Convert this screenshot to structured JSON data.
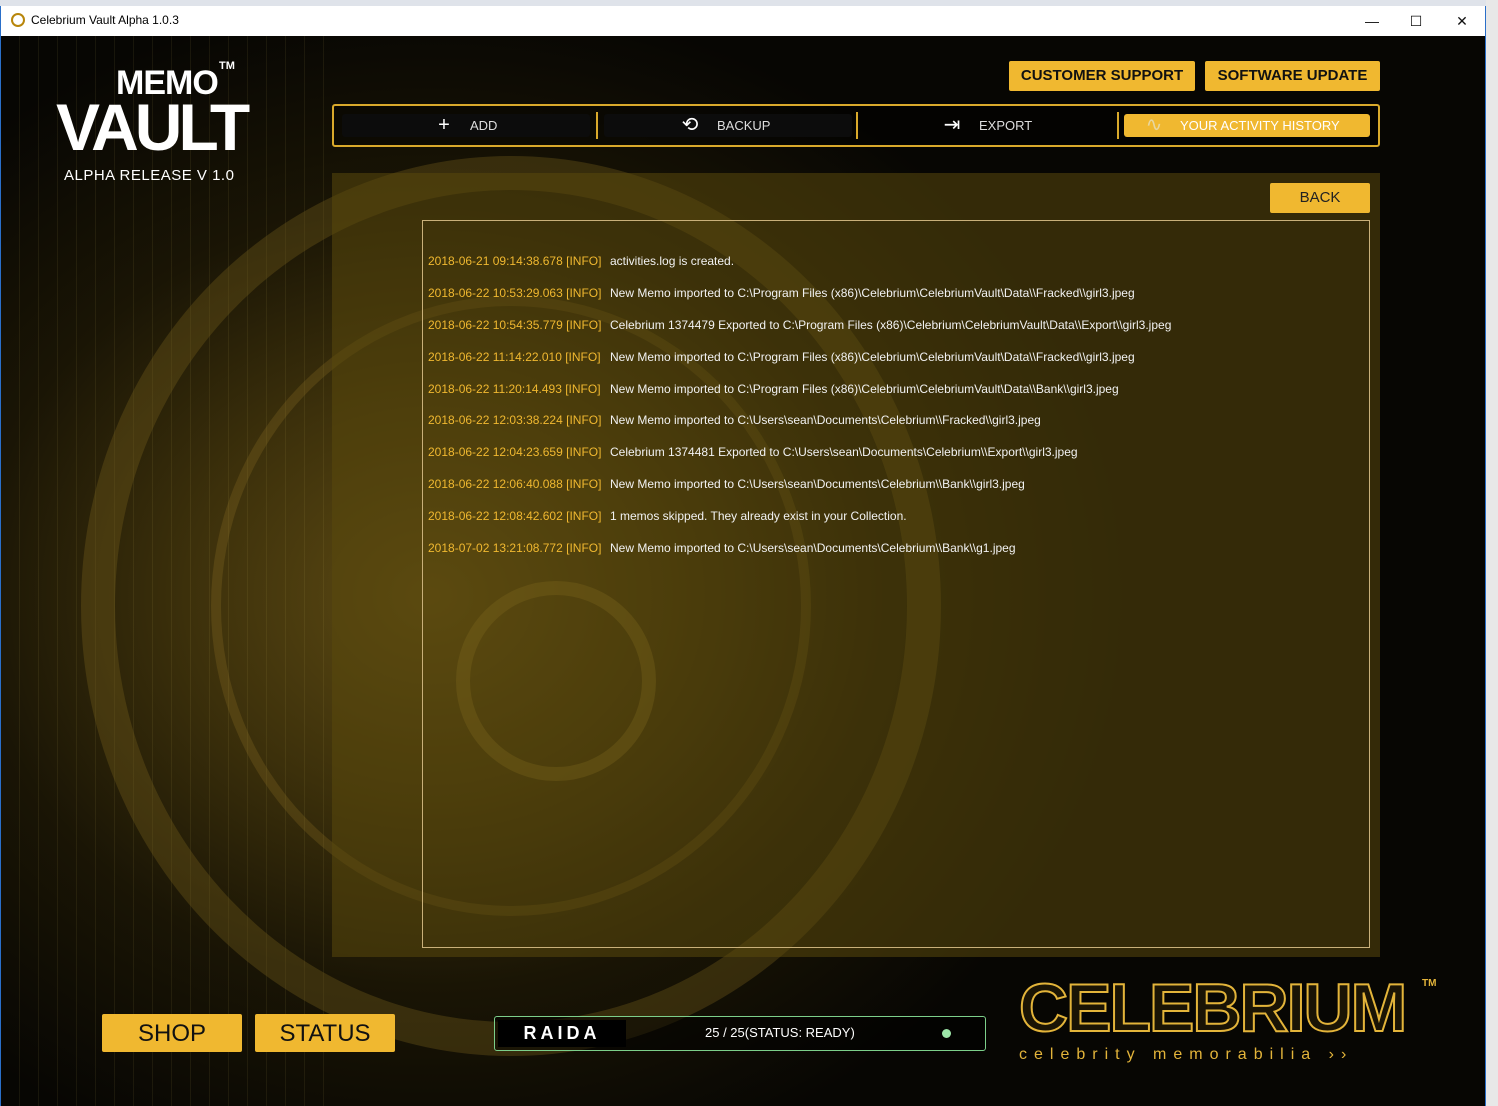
{
  "window": {
    "title": "Celebrium Vault Alpha 1.0.3",
    "minimize_glyph": "—",
    "maximize_glyph": "☐",
    "close_glyph": "✕"
  },
  "logo": {
    "memo": "MEMO",
    "tm": "TM",
    "vault": "VAULT",
    "release": "ALPHA RELEASE V 1.0"
  },
  "header": {
    "customer_support": "CUSTOMER SUPPORT",
    "software_update": "SOFTWARE UPDATE"
  },
  "toolbar": {
    "add": {
      "label": "ADD",
      "icon": "plus-icon"
    },
    "backup": {
      "label": "BACKUP",
      "icon": "history-clock-icon"
    },
    "export": {
      "label": "EXPORT",
      "icon": "export-icon"
    },
    "history": {
      "label": "YOUR ACTIVITY HISTORY",
      "icon": "activity-pulse-icon",
      "active": true
    }
  },
  "panel": {
    "back_label": "BACK",
    "log": [
      {
        "ts": "2018-06-21 09:14:38.678 [INFO]",
        "msg": "activities.log is created."
      },
      {
        "ts": "2018-06-22 10:53:29.063 [INFO]",
        "msg": "New Memo imported to C:\\Program Files (x86)\\Celebrium\\CelebriumVault\\Data\\\\Fracked\\\\girl3.jpeg"
      },
      {
        "ts": "2018-06-22 10:54:35.779 [INFO]",
        "msg": "Celebrium 1374479 Exported to C:\\Program Files (x86)\\Celebrium\\CelebriumVault\\Data\\\\Export\\\\girl3.jpeg"
      },
      {
        "ts": "2018-06-22 11:14:22.010 [INFO]",
        "msg": "New Memo imported to C:\\Program Files (x86)\\Celebrium\\CelebriumVault\\Data\\\\Fracked\\\\girl3.jpeg"
      },
      {
        "ts": "2018-06-22 11:20:14.493 [INFO]",
        "msg": "New Memo imported to C:\\Program Files (x86)\\Celebrium\\CelebriumVault\\Data\\\\Bank\\\\girl3.jpeg"
      },
      {
        "ts": "2018-06-22 12:03:38.224 [INFO]",
        "msg": "New Memo imported to C:\\Users\\sean\\Documents\\Celebrium\\\\Fracked\\\\girl3.jpeg"
      },
      {
        "ts": "2018-06-22 12:04:23.659 [INFO]",
        "msg": "Celebrium 1374481 Exported to C:\\Users\\sean\\Documents\\Celebrium\\\\Export\\\\girl3.jpeg"
      },
      {
        "ts": "2018-06-22 12:06:40.088 [INFO]",
        "msg": "New Memo imported to C:\\Users\\sean\\Documents\\Celebrium\\\\Bank\\\\girl3.jpeg"
      },
      {
        "ts": "2018-06-22 12:08:42.602 [INFO]",
        "msg": "1 memos skipped. They already exist in your Collection."
      },
      {
        "ts": "2018-07-02 13:21:08.772 [INFO]",
        "msg": "New Memo imported to C:\\Users\\sean\\Documents\\Celebrium\\\\Bank\\\\g1.jpeg"
      }
    ]
  },
  "footer": {
    "shop": "SHOP",
    "status": "STATUS",
    "raida_logo": "RAIDA",
    "raida_status": "25 / 25(STATUS: READY)",
    "raida_dot_color": "#9de6a8",
    "brand": "CELEBRIUM",
    "brand_tm": "TM",
    "tagline": "celebrity memorabilia ››"
  },
  "colors": {
    "accent": "#f0b830",
    "log_timestamp": "#f0b830",
    "log_text": "#f2f2f2"
  }
}
